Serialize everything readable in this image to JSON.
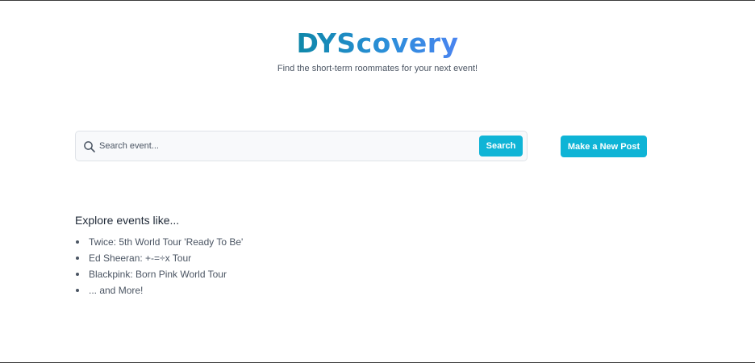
{
  "header": {
    "logo": "DYScovery",
    "tagline": "Find the short-term roommates for your next event!"
  },
  "search": {
    "placeholder": "Search event...",
    "value": "",
    "button_label": "Search"
  },
  "actions": {
    "new_post_label": "Make a New Post"
  },
  "explore": {
    "title": "Explore events like...",
    "items": [
      "Twice: 5th World Tour 'Ready To Be'",
      "Ed Sheeran: +-=÷x Tour",
      "Blackpink: Born Pink World Tour",
      "... and More!"
    ]
  },
  "colors": {
    "accent": "#0fb4d6",
    "logo_gradient_start": "#0e87a8",
    "logo_gradient_end": "#4a84f0"
  }
}
